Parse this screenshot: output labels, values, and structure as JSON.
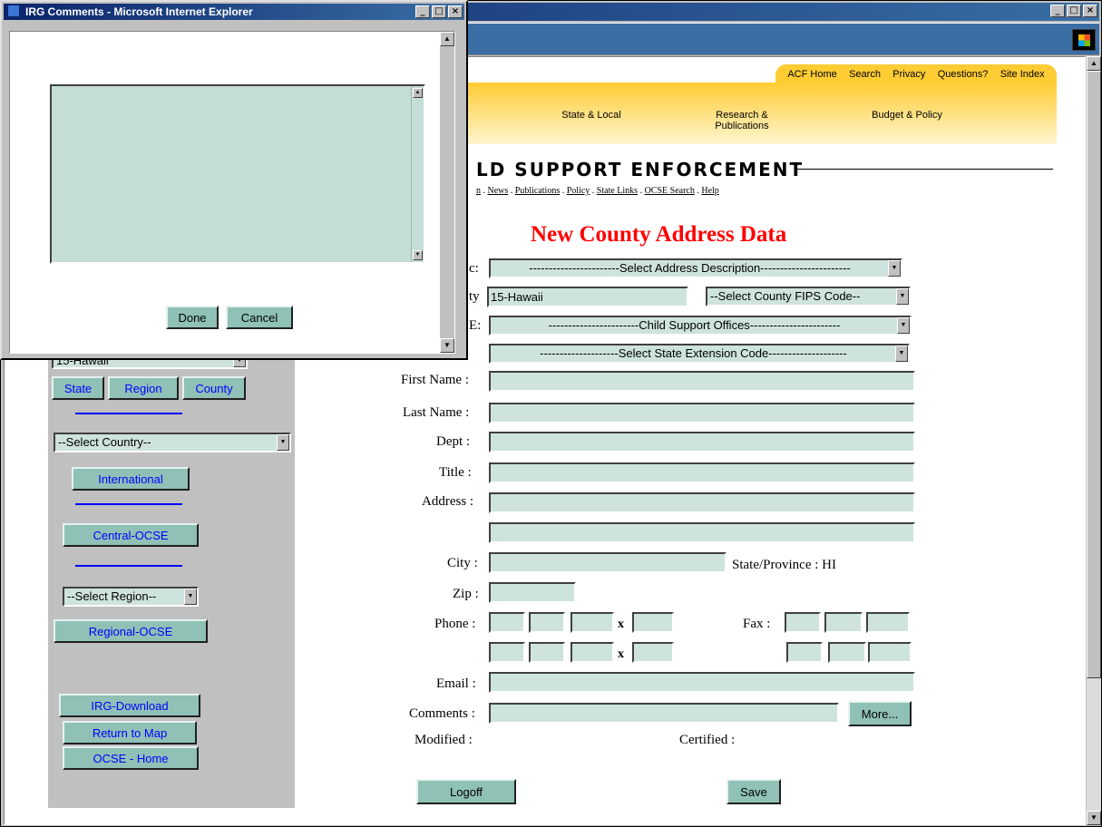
{
  "main_window": {
    "title": "",
    "controls": {
      "minimize": "_",
      "maximize": "□",
      "close": "×"
    }
  },
  "acf_header": {
    "links": [
      "ACF Home",
      "Search",
      "Privacy",
      "Questions?",
      "Site Index"
    ],
    "nav": {
      "state_local": "State & Local",
      "research_line1": "Research &",
      "research_line2": "Publications",
      "budget": "Budget & Policy"
    }
  },
  "ocse": {
    "title": "LD SUPPORT ENFORCEMENT",
    "links_prefix": "n",
    "links": [
      "News",
      "Publications",
      "Policy",
      "State Links",
      "OCSE Search",
      "Help"
    ]
  },
  "page_heading": "New County Address Data",
  "sidebar": {
    "state_select": "15-Hawaii",
    "state_btn": "State",
    "region_btn": "Region",
    "county_btn": "County",
    "country_select": "--Select Country--",
    "international_btn": "International",
    "central_btn": "Central-OCSE",
    "region_select": "--Select Region--",
    "regional_btn": "Regional-OCSE",
    "download_btn": "IRG-Download",
    "return_btn": "Return to Map",
    "home_btn": "OCSE - Home"
  },
  "form": {
    "labels": {
      "desc_partial": "c:",
      "county_partial": "ty",
      "type_partial": "E:",
      "first_name": "First Name :",
      "last_name": "Last Name :",
      "dept": "Dept :",
      "title": "Title :",
      "address": "Address :",
      "city": "City :",
      "state_province": "State/Province : HI",
      "zip": "Zip :",
      "phone": "Phone :",
      "fax": "Fax :",
      "email": "Email :",
      "comments": "Comments :",
      "modified": "Modified :",
      "certified": "Certified :",
      "x": "x"
    },
    "address_desc_select": "-----------------------Select Address Description-----------------------",
    "county_value": "15-Hawaii",
    "fips_select": "--Select County FIPS Code--",
    "office_type_select": "-----------------------Child Support Offices-----------------------",
    "extension_select": "--------------------Select State Extension Code--------------------",
    "more_btn": "More...",
    "logoff_btn": "Logoff",
    "save_btn": "Save"
  },
  "popup": {
    "title": "IRG Comments - Microsoft Internet Explorer",
    "done_btn": "Done",
    "cancel_btn": "Cancel"
  }
}
